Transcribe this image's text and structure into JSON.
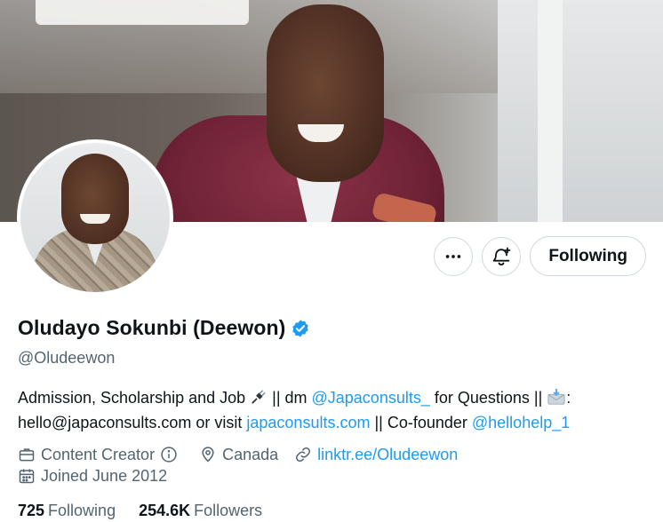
{
  "profile": {
    "display_name": "Oludayo Sokunbi (Deewon)",
    "handle": "@Oludeewon",
    "verified": true,
    "bio": {
      "part1": "Admission, Scholarship and Job ",
      "part2": " || dm ",
      "mention1": "@Japaconsults_",
      "part3": " for Questions || ",
      "part4": ":",
      "part5": "hello@japaconsults.com or visit ",
      "link": "japaconsults.com",
      "part6": " || Co-founder ",
      "mention2": "@hellohelp_1"
    },
    "category": "Content Creator",
    "location": "Canada",
    "website": "linktr.ee/Oludeewon",
    "joined": "Joined June 2012",
    "following_count": "725",
    "following_label": "Following",
    "followers_count": "254.6K",
    "followers_label": "Followers"
  },
  "actions": {
    "more_icon": "more-horizontal-icon",
    "notify_icon": "bell-plus-icon",
    "follow_label": "Following"
  },
  "colors": {
    "accent": "#1d9bf0",
    "text_primary": "#0f1419",
    "text_secondary": "#536471",
    "border": "#cfd9de"
  }
}
